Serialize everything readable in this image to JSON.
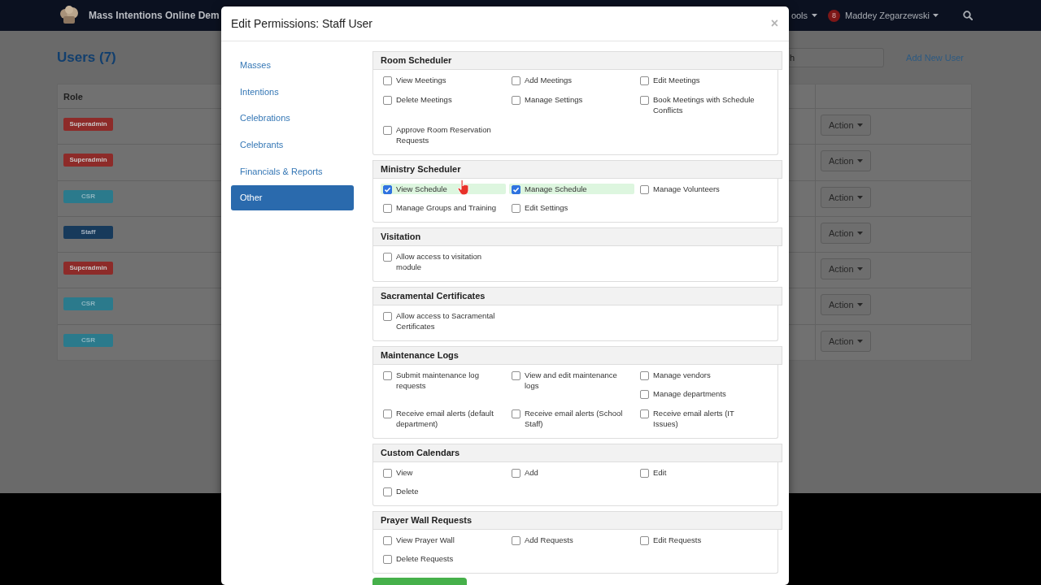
{
  "navbar": {
    "brand": "Mass Intentions Online Dem",
    "menus": [
      {
        "label": "ools"
      }
    ],
    "user": {
      "badge": "8",
      "name": "Maddey Zegarzewski"
    }
  },
  "page": {
    "title": "Users (7)",
    "search": {
      "placeholder": "h"
    },
    "add_link": "Add New User",
    "table": {
      "columns": [
        "Role"
      ],
      "rows": [
        {
          "role": "Superadmin",
          "kind": "superadmin",
          "action": "Action"
        },
        {
          "role": "Superadmin",
          "kind": "superadmin",
          "action": "Action"
        },
        {
          "role": "CSR",
          "kind": "csr",
          "action": "Action"
        },
        {
          "role": "Staff",
          "kind": "staff",
          "action": "Action"
        },
        {
          "role": "Superadmin",
          "kind": "superadmin",
          "action": "Action"
        },
        {
          "role": "CSR",
          "kind": "csr",
          "action": "Action"
        },
        {
          "role": "CSR",
          "kind": "csr",
          "action": "Action"
        }
      ]
    }
  },
  "modal": {
    "title": "Edit Permissions: Staff User",
    "close": "×",
    "nav": [
      {
        "label": "Masses",
        "selected": false
      },
      {
        "label": "Intentions",
        "selected": false
      },
      {
        "label": "Celebrations",
        "selected": false
      },
      {
        "label": "Celebrants",
        "selected": false
      },
      {
        "label": "Financials & Reports",
        "selected": false
      },
      {
        "label": "Other",
        "selected": true
      }
    ],
    "sections": [
      {
        "title": "Room Scheduler",
        "rows": [
          [
            [
              {
                "label": "View Meetings",
                "checked": false
              }
            ],
            [
              {
                "label": "Add Meetings",
                "checked": false
              }
            ],
            [
              {
                "label": "Edit Meetings",
                "checked": false
              }
            ]
          ],
          [
            [
              {
                "label": "Delete Meetings",
                "checked": false
              }
            ],
            [
              {
                "label": "Manage Settings",
                "checked": false
              }
            ],
            [
              {
                "label": "Book Meetings with Schedule Conflicts",
                "checked": false
              }
            ]
          ],
          [
            [
              {
                "label": "Approve Room Reservation Requests",
                "checked": false
              }
            ]
          ]
        ]
      },
      {
        "title": "Ministry Scheduler",
        "rows": [
          [
            [
              {
                "label": "View Schedule",
                "checked": true
              }
            ],
            [
              {
                "label": "Manage Schedule",
                "checked": true
              }
            ],
            [
              {
                "label": "Manage Volunteers",
                "checked": false
              }
            ]
          ],
          [
            [
              {
                "label": "Manage Groups and Training",
                "checked": false
              }
            ],
            [
              {
                "label": "Edit Settings",
                "checked": false
              }
            ]
          ]
        ]
      },
      {
        "title": "Visitation",
        "rows": [
          [
            [
              {
                "label": "Allow access to visitation module",
                "checked": false
              }
            ]
          ]
        ]
      },
      {
        "title": "Sacramental Certificates",
        "rows": [
          [
            [
              {
                "label": "Allow access to Sacramental Certificates",
                "checked": false
              }
            ]
          ]
        ]
      },
      {
        "title": "Maintenance Logs",
        "rows": [
          [
            [
              {
                "label": "Submit maintenance log requests",
                "checked": false
              }
            ],
            [
              {
                "label": "View and edit maintenance logs",
                "checked": false
              }
            ],
            [
              {
                "label": "Manage vendors",
                "checked": false
              },
              {
                "label": "Manage departments",
                "checked": false
              }
            ]
          ],
          [
            [
              {
                "label": "Receive email alerts (default department)",
                "checked": false
              }
            ],
            [
              {
                "label": "Receive email alerts (School Staff)",
                "checked": false
              }
            ],
            [
              {
                "label": "Receive email alerts (IT Issues)",
                "checked": false
              }
            ]
          ]
        ]
      },
      {
        "title": "Custom Calendars",
        "rows": [
          [
            [
              {
                "label": "View",
                "checked": false
              }
            ],
            [
              {
                "label": "Add",
                "checked": false
              }
            ],
            [
              {
                "label": "Edit",
                "checked": false
              }
            ]
          ],
          [
            [
              {
                "label": "Delete",
                "checked": false
              }
            ]
          ]
        ]
      },
      {
        "title": "Prayer Wall Requests",
        "rows": [
          [
            [
              {
                "label": "View Prayer Wall",
                "checked": false
              }
            ],
            [
              {
                "label": "Add Requests",
                "checked": false
              }
            ],
            [
              {
                "label": "Edit Requests",
                "checked": false
              }
            ]
          ],
          [
            [
              {
                "label": "Delete Requests",
                "checked": false
              }
            ]
          ]
        ]
      }
    ]
  }
}
